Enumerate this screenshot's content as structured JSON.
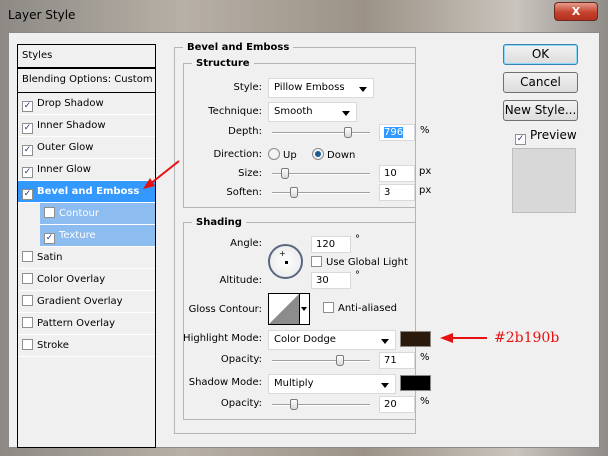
{
  "window": {
    "title": "Layer Style",
    "close": "X"
  },
  "sidebar": {
    "header": "Styles",
    "blending": "Blending Options: Custom",
    "items": [
      {
        "label": "Drop Shadow",
        "checked": true
      },
      {
        "label": "Inner Shadow",
        "checked": true
      },
      {
        "label": "Outer Glow",
        "checked": true
      },
      {
        "label": "Inner Glow",
        "checked": true
      },
      {
        "label": "Bevel and Emboss",
        "checked": true
      },
      {
        "label": "Contour",
        "checked": false
      },
      {
        "label": "Texture",
        "checked": true
      },
      {
        "label": "Satin",
        "checked": false
      },
      {
        "label": "Color Overlay",
        "checked": false
      },
      {
        "label": "Gradient Overlay",
        "checked": false
      },
      {
        "label": "Pattern Overlay",
        "checked": false
      },
      {
        "label": "Stroke",
        "checked": false
      }
    ]
  },
  "main": {
    "title": "Bevel and Emboss",
    "structure": {
      "title": "Structure",
      "style_label": "Style:",
      "style": "Pillow Emboss",
      "technique_label": "Technique:",
      "technique": "Smooth",
      "depth_label": "Depth:",
      "depth": "796",
      "depth_pct": 0.8,
      "pct": "%",
      "direction_label": "Direction:",
      "up": "Up",
      "down": "Down",
      "size_label": "Size:",
      "size": "10",
      "size_pct": 0.1,
      "px": "px",
      "soften_label": "Soften:",
      "soften": "3",
      "soften_pct": 0.2
    },
    "shading": {
      "title": "Shading",
      "angle_label": "Angle:",
      "angle": "120",
      "deg": "°",
      "global_light": "Use Global Light",
      "altitude_label": "Altitude:",
      "altitude": "30",
      "gloss_label": "Gloss Contour:",
      "anti_aliased": "Anti-aliased",
      "highlight_label": "Highlight Mode:",
      "highlight_mode": "Color Dodge",
      "highlight_color": "#2b190b",
      "opacity_label": "Opacity:",
      "highlight_opacity": "71",
      "highlight_opacity_pct": 0.71,
      "shadow_label": "Shadow Mode:",
      "shadow_mode": "Multiply",
      "shadow_color": "#000000",
      "shadow_opacity": "20",
      "shadow_opacity_pct": 0.2
    }
  },
  "buttons": {
    "ok": "OK",
    "cancel": "Cancel",
    "new_style": "New Style...",
    "preview": "Preview"
  },
  "annotation": {
    "text": "#2b190b"
  }
}
